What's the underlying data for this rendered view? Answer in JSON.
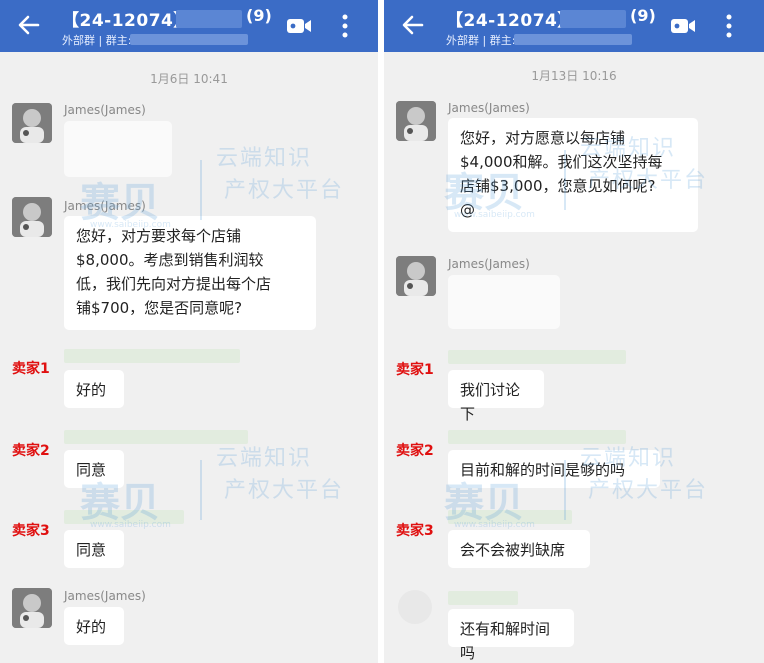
{
  "header": {
    "title": "【24-12074】",
    "member_count": "(9)",
    "subtitle_prefix": "外部群 | 群主:"
  },
  "watermark": {
    "logo": "赛贝",
    "site": "www.saibeiip.com",
    "slogan_line1": "云端知识",
    "slogan_line2": "产权大平台"
  },
  "left": {
    "timestamp": "1月6日  10:41",
    "messages": [
      {
        "sender": "James(James)"
      },
      {
        "sender": "James(James)",
        "text": "您好，对方要求每个店铺\n$8,000。考虑到销售利润较\n低，我们先向对方提出每个店\n铺$700，您是否同意呢?"
      },
      {
        "avatar_label": "卖家1",
        "text": "好的"
      },
      {
        "avatar_label": "卖家2",
        "text": "同意"
      },
      {
        "avatar_label": "卖家3",
        "text": "同意"
      },
      {
        "sender": "James(James)",
        "text": "好的"
      }
    ]
  },
  "right": {
    "timestamp": "1月13日  10:16",
    "messages": [
      {
        "sender": "James(James)",
        "text": "您好，对方愿意以每店铺\n$4,000和解。我们这次坚持每\n店铺$3,000，您意见如何呢?\n@"
      },
      {
        "sender": "James(James)"
      },
      {
        "avatar_label": "卖家1",
        "text": "我们讨论下"
      },
      {
        "avatar_label": "卖家2",
        "text": "目前和解的时间是够的吗"
      },
      {
        "avatar_label": "卖家3",
        "text": "会不会被判缺席"
      },
      {
        "text": "还有和解时间吗"
      }
    ]
  },
  "colors": {
    "header": "#3b6cc6",
    "seller_label": "#e01010",
    "chat_bg": "#f0f0f0"
  },
  "icons": [
    "back-arrow-icon",
    "video-call-icon",
    "more-vertical-icon"
  ]
}
